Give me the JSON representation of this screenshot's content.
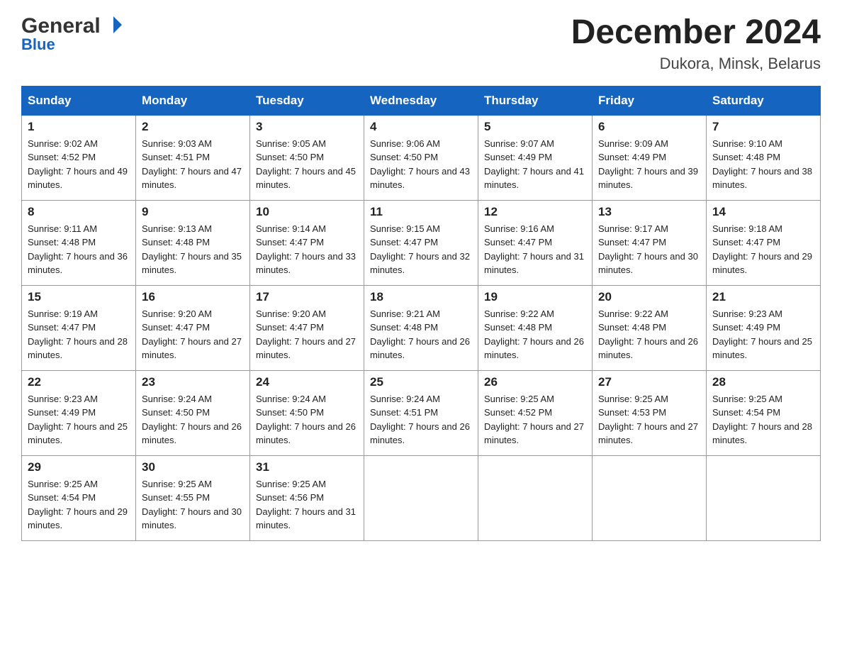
{
  "logo": {
    "general": "General",
    "blue": "Blue"
  },
  "header": {
    "month": "December 2024",
    "location": "Dukora, Minsk, Belarus"
  },
  "days_of_week": [
    "Sunday",
    "Monday",
    "Tuesday",
    "Wednesday",
    "Thursday",
    "Friday",
    "Saturday"
  ],
  "weeks": [
    [
      {
        "day": 1,
        "sunrise": "9:02 AM",
        "sunset": "4:52 PM",
        "daylight": "7 hours and 49 minutes."
      },
      {
        "day": 2,
        "sunrise": "9:03 AM",
        "sunset": "4:51 PM",
        "daylight": "7 hours and 47 minutes."
      },
      {
        "day": 3,
        "sunrise": "9:05 AM",
        "sunset": "4:50 PM",
        "daylight": "7 hours and 45 minutes."
      },
      {
        "day": 4,
        "sunrise": "9:06 AM",
        "sunset": "4:50 PM",
        "daylight": "7 hours and 43 minutes."
      },
      {
        "day": 5,
        "sunrise": "9:07 AM",
        "sunset": "4:49 PM",
        "daylight": "7 hours and 41 minutes."
      },
      {
        "day": 6,
        "sunrise": "9:09 AM",
        "sunset": "4:49 PM",
        "daylight": "7 hours and 39 minutes."
      },
      {
        "day": 7,
        "sunrise": "9:10 AM",
        "sunset": "4:48 PM",
        "daylight": "7 hours and 38 minutes."
      }
    ],
    [
      {
        "day": 8,
        "sunrise": "9:11 AM",
        "sunset": "4:48 PM",
        "daylight": "7 hours and 36 minutes."
      },
      {
        "day": 9,
        "sunrise": "9:13 AM",
        "sunset": "4:48 PM",
        "daylight": "7 hours and 35 minutes."
      },
      {
        "day": 10,
        "sunrise": "9:14 AM",
        "sunset": "4:47 PM",
        "daylight": "7 hours and 33 minutes."
      },
      {
        "day": 11,
        "sunrise": "9:15 AM",
        "sunset": "4:47 PM",
        "daylight": "7 hours and 32 minutes."
      },
      {
        "day": 12,
        "sunrise": "9:16 AM",
        "sunset": "4:47 PM",
        "daylight": "7 hours and 31 minutes."
      },
      {
        "day": 13,
        "sunrise": "9:17 AM",
        "sunset": "4:47 PM",
        "daylight": "7 hours and 30 minutes."
      },
      {
        "day": 14,
        "sunrise": "9:18 AM",
        "sunset": "4:47 PM",
        "daylight": "7 hours and 29 minutes."
      }
    ],
    [
      {
        "day": 15,
        "sunrise": "9:19 AM",
        "sunset": "4:47 PM",
        "daylight": "7 hours and 28 minutes."
      },
      {
        "day": 16,
        "sunrise": "9:20 AM",
        "sunset": "4:47 PM",
        "daylight": "7 hours and 27 minutes."
      },
      {
        "day": 17,
        "sunrise": "9:20 AM",
        "sunset": "4:47 PM",
        "daylight": "7 hours and 27 minutes."
      },
      {
        "day": 18,
        "sunrise": "9:21 AM",
        "sunset": "4:48 PM",
        "daylight": "7 hours and 26 minutes."
      },
      {
        "day": 19,
        "sunrise": "9:22 AM",
        "sunset": "4:48 PM",
        "daylight": "7 hours and 26 minutes."
      },
      {
        "day": 20,
        "sunrise": "9:22 AM",
        "sunset": "4:48 PM",
        "daylight": "7 hours and 26 minutes."
      },
      {
        "day": 21,
        "sunrise": "9:23 AM",
        "sunset": "4:49 PM",
        "daylight": "7 hours and 25 minutes."
      }
    ],
    [
      {
        "day": 22,
        "sunrise": "9:23 AM",
        "sunset": "4:49 PM",
        "daylight": "7 hours and 25 minutes."
      },
      {
        "day": 23,
        "sunrise": "9:24 AM",
        "sunset": "4:50 PM",
        "daylight": "7 hours and 26 minutes."
      },
      {
        "day": 24,
        "sunrise": "9:24 AM",
        "sunset": "4:50 PM",
        "daylight": "7 hours and 26 minutes."
      },
      {
        "day": 25,
        "sunrise": "9:24 AM",
        "sunset": "4:51 PM",
        "daylight": "7 hours and 26 minutes."
      },
      {
        "day": 26,
        "sunrise": "9:25 AM",
        "sunset": "4:52 PM",
        "daylight": "7 hours and 27 minutes."
      },
      {
        "day": 27,
        "sunrise": "9:25 AM",
        "sunset": "4:53 PM",
        "daylight": "7 hours and 27 minutes."
      },
      {
        "day": 28,
        "sunrise": "9:25 AM",
        "sunset": "4:54 PM",
        "daylight": "7 hours and 28 minutes."
      }
    ],
    [
      {
        "day": 29,
        "sunrise": "9:25 AM",
        "sunset": "4:54 PM",
        "daylight": "7 hours and 29 minutes."
      },
      {
        "day": 30,
        "sunrise": "9:25 AM",
        "sunset": "4:55 PM",
        "daylight": "7 hours and 30 minutes."
      },
      {
        "day": 31,
        "sunrise": "9:25 AM",
        "sunset": "4:56 PM",
        "daylight": "7 hours and 31 minutes."
      },
      null,
      null,
      null,
      null
    ]
  ]
}
